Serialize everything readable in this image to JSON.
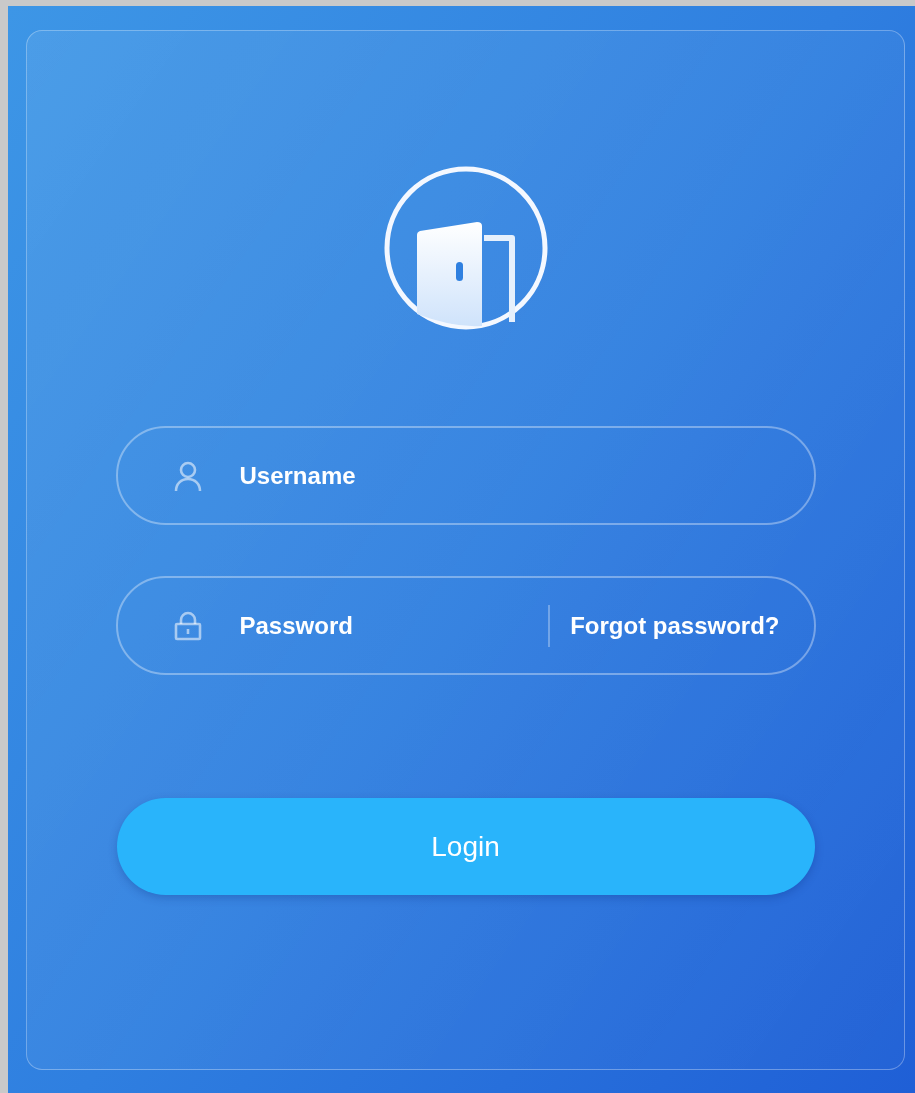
{
  "fields": [
    {
      "kind": "username",
      "placeholder": "Username"
    },
    {
      "kind": "password",
      "placeholder": "Password",
      "link": "Forgot password?"
    }
  ],
  "login_button": "Login"
}
